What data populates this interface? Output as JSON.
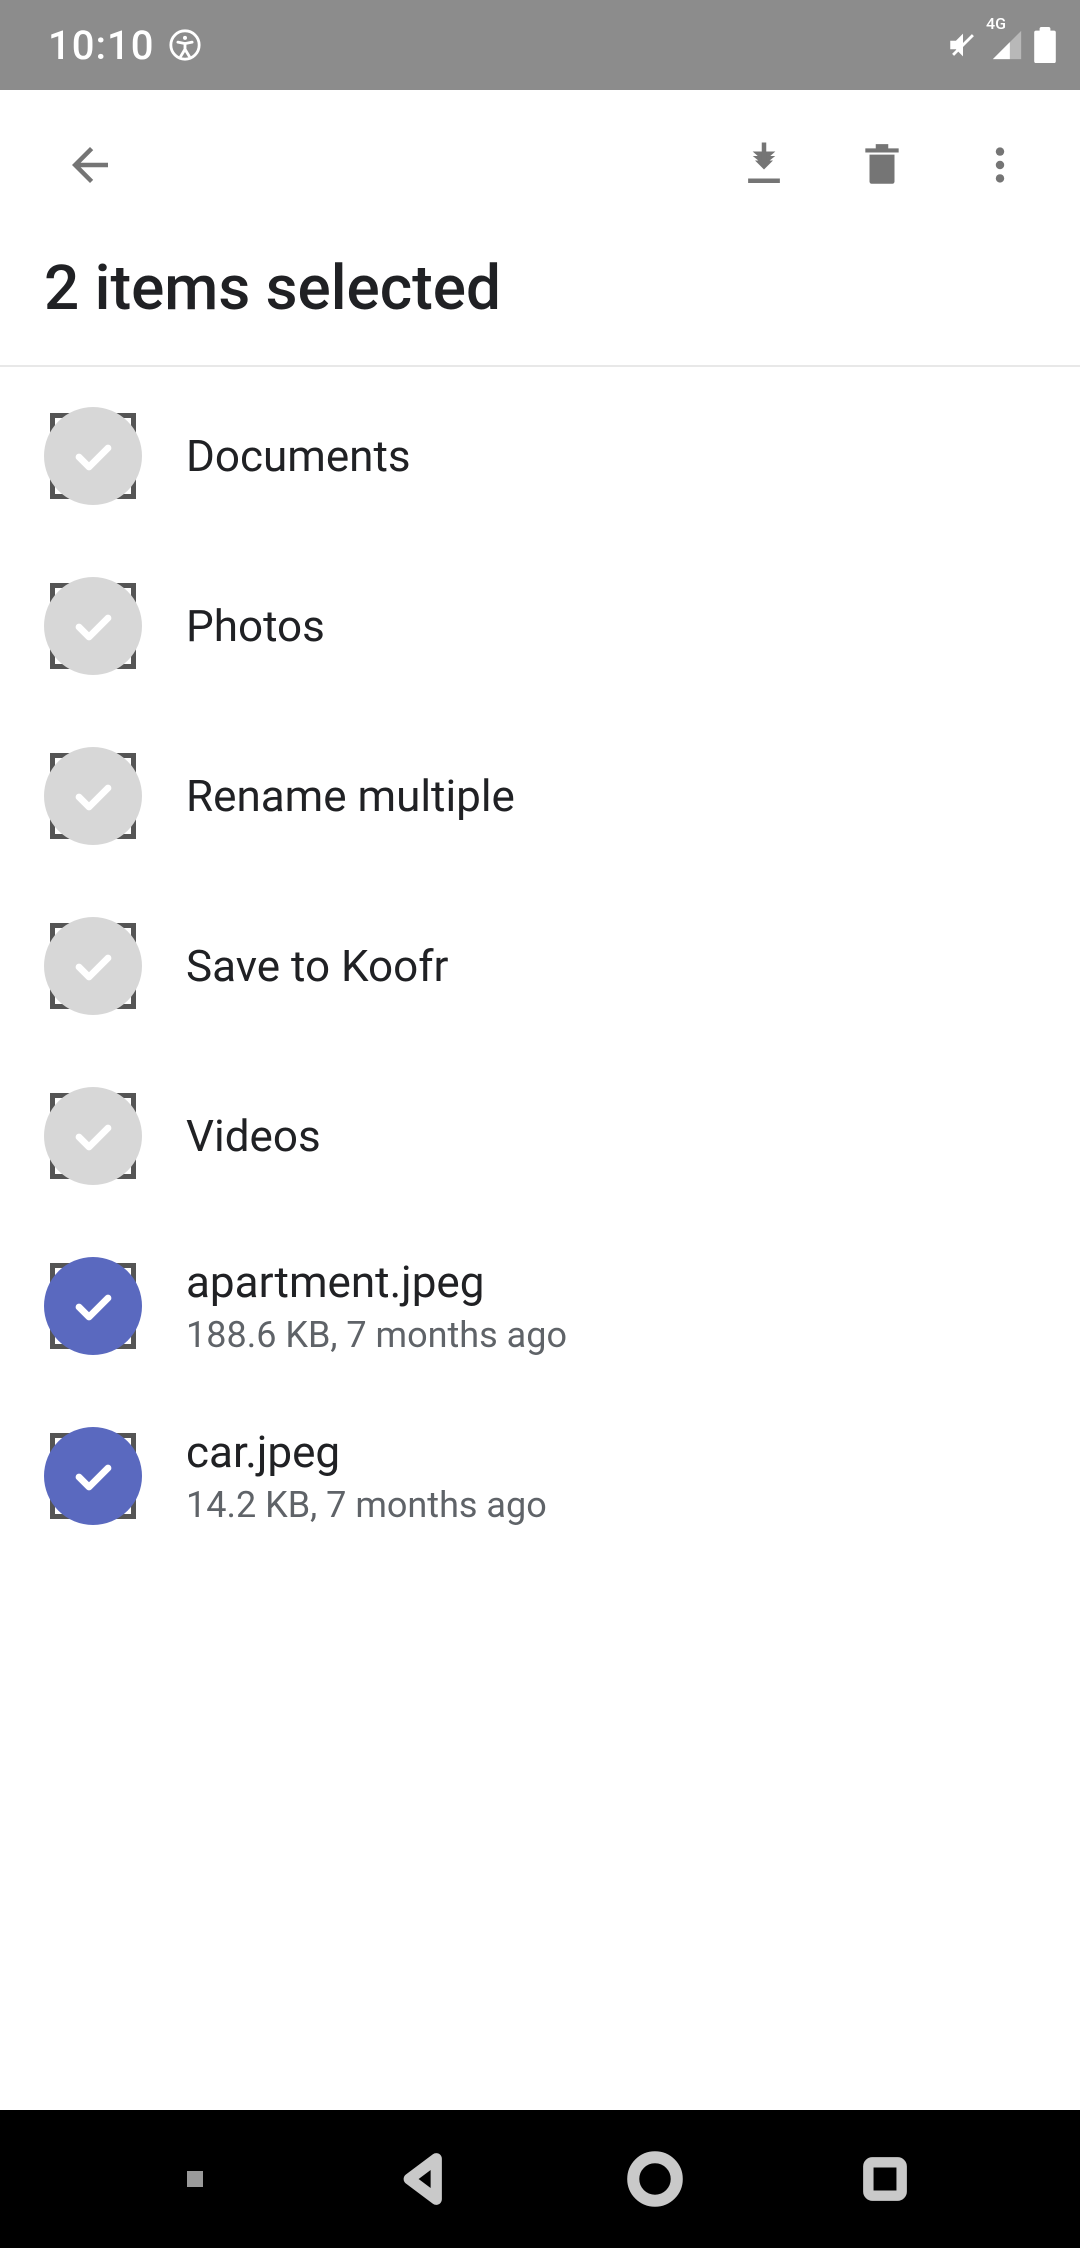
{
  "status": {
    "time": "10:10",
    "network_label": "4G"
  },
  "header": {
    "title": "2 items selected"
  },
  "items": [
    {
      "name": "Documents",
      "meta": "",
      "selected": false
    },
    {
      "name": "Photos",
      "meta": "",
      "selected": false
    },
    {
      "name": "Rename multiple",
      "meta": "",
      "selected": false
    },
    {
      "name": "Save to Koofr",
      "meta": "",
      "selected": false
    },
    {
      "name": "Videos",
      "meta": "",
      "selected": false
    },
    {
      "name": "apartment.jpeg",
      "meta": "188.6 KB, 7 months ago",
      "selected": true
    },
    {
      "name": "car.jpeg",
      "meta": "14.2 KB, 7 months ago",
      "selected": true
    }
  ]
}
